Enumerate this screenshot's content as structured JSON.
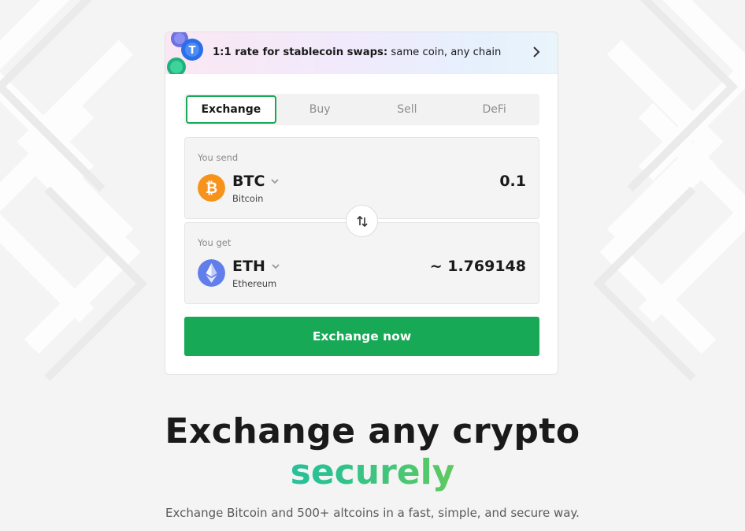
{
  "promo": {
    "bold_text": "1:1 rate for stablecoin swaps:",
    "text": " same coin, any chain"
  },
  "tabs": [
    {
      "label": "Exchange",
      "active": true
    },
    {
      "label": "Buy",
      "active": false
    },
    {
      "label": "Sell",
      "active": false
    },
    {
      "label": "DeFi",
      "active": false
    }
  ],
  "send": {
    "label": "You send",
    "ticker": "BTC",
    "name": "Bitcoin",
    "amount": "0.1",
    "icon": "bitcoin-icon",
    "color": "#f7931a"
  },
  "get": {
    "label": "You get",
    "ticker": "ETH",
    "name": "Ethereum",
    "amount": "~ 1.769148",
    "icon": "ethereum-icon",
    "color": "#627eea"
  },
  "cta": {
    "label": "Exchange now"
  },
  "hero": {
    "title": "Exchange any crypto",
    "accent": "securely",
    "subtitle": "Exchange Bitcoin and 500+ altcoins in a fast, simple, and secure way."
  },
  "colors": {
    "brand_green": "#17a955",
    "background": "#f4f4f5",
    "accent_gradient": [
      "#10b3e6",
      "#2dc28e",
      "#9bd229",
      "#c4dd1d"
    ]
  }
}
